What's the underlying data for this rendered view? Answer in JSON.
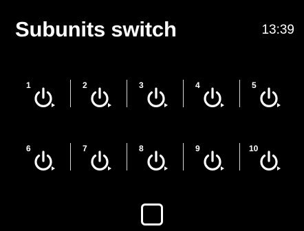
{
  "header": {
    "title": "Subunits switch",
    "time": "13:39"
  },
  "units": [
    {
      "number": "1",
      "icon": "power-icon"
    },
    {
      "number": "2",
      "icon": "power-icon"
    },
    {
      "number": "3",
      "icon": "power-icon"
    },
    {
      "number": "4",
      "icon": "power-icon"
    },
    {
      "number": "5",
      "icon": "power-icon"
    },
    {
      "number": "6",
      "icon": "power-icon"
    },
    {
      "number": "7",
      "icon": "power-icon"
    },
    {
      "number": "8",
      "icon": "power-icon"
    },
    {
      "number": "9",
      "icon": "power-icon"
    },
    {
      "number": "10",
      "icon": "power-icon"
    }
  ],
  "select_all": {
    "checked": false
  },
  "colors": {
    "background": "#000000",
    "foreground": "#ffffff"
  }
}
